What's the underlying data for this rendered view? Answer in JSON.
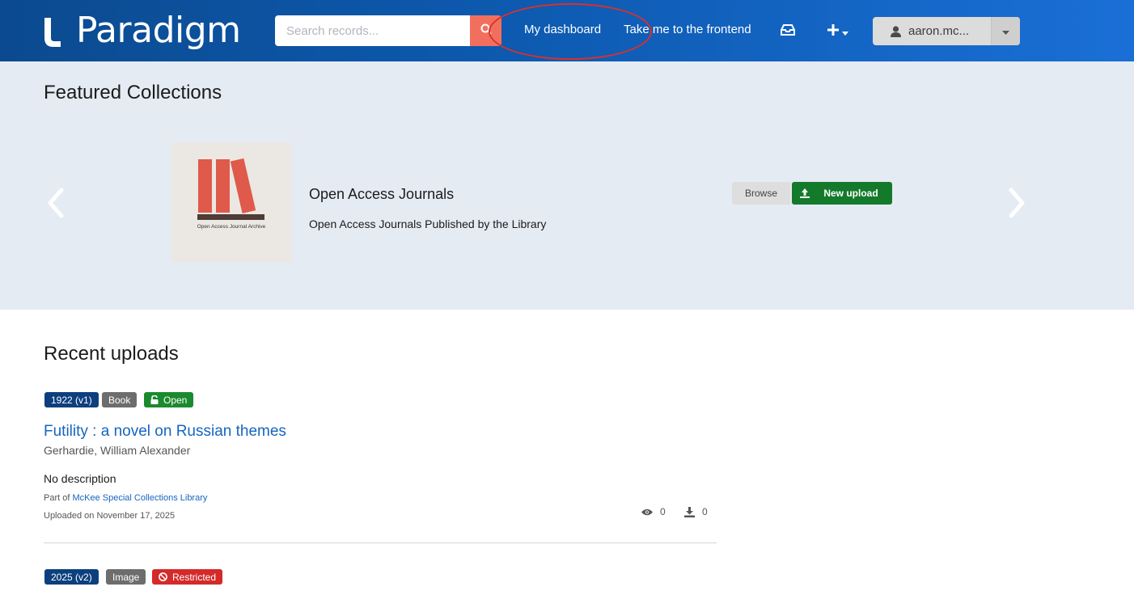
{
  "header": {
    "brand": "Paradigm",
    "search_placeholder": "Search records...",
    "nav": {
      "dashboard": "My dashboard",
      "frontend": "Take me to the frontend"
    },
    "icons": {
      "inbox": "inbox-icon",
      "add": "plus-icon",
      "user": "user-icon"
    },
    "user_label": "aaron.mc..."
  },
  "featured": {
    "heading": "Featured Collections",
    "collection": {
      "thumbnail_caption": "Open Access Journal Archive",
      "title": "Open Access Journals",
      "description": "Open Access Journals Published by the Library",
      "browse_label": "Browse",
      "upload_label": "New upload"
    }
  },
  "recent": {
    "heading": "Recent uploads",
    "items": [
      {
        "badges": {
          "version": "1922 (v1)",
          "type": "Book",
          "access": "Open"
        },
        "title": "Futility : a novel on Russian themes",
        "author": "Gerhardie, William Alexander",
        "description": "No description",
        "part_of_prefix": "Part of",
        "part_of_link": "McKee Special Collections Library",
        "uploaded": "Uploaded on November 17, 2025",
        "views": "0",
        "downloads": "0"
      },
      {
        "badges": {
          "version": "2025 (v2)",
          "type": "Image",
          "access": "Restricted"
        }
      }
    ]
  },
  "colors": {
    "header_start": "#0b4a8f",
    "header_end": "#1a6fd6",
    "search_button": "#f26f5e",
    "featured_bg": "#e5ebf3",
    "upload_button": "#137a2b",
    "badge_version": "#0c3f7d",
    "badge_open": "#1b8a2e",
    "badge_restricted": "#d42a2a",
    "link": "#1565c0",
    "annotation": "#d8312c"
  }
}
